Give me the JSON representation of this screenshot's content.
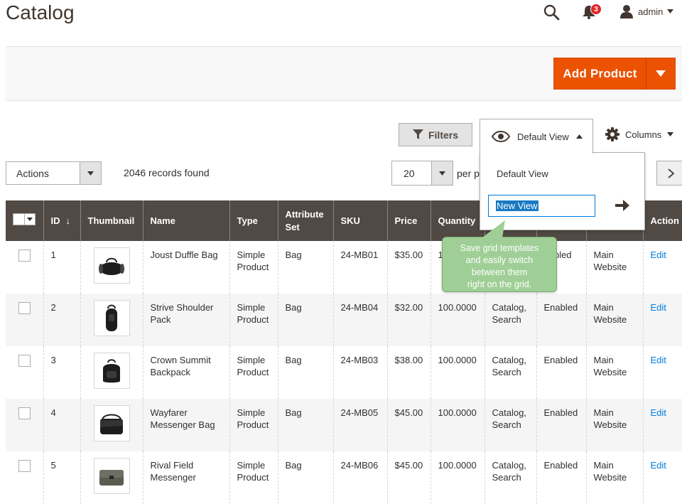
{
  "header": {
    "title": "Catalog",
    "notifications_count": "3",
    "user": "admin"
  },
  "page_actions": {
    "add_product_label": "Add Product"
  },
  "toolbar": {
    "filters_label": "Filters",
    "view_label": "Default View",
    "columns_label": "Columns",
    "actions_label": "Actions",
    "records_found": "2046 records found",
    "per_page_value": "20",
    "per_page_label": "per p"
  },
  "view_menu": {
    "default_item": "Default View",
    "new_view_value": "New View"
  },
  "tooltip": {
    "line1": "Save grid templates",
    "line2": "and easily switch",
    "line3": "between them",
    "line4": "right on the grid."
  },
  "grid": {
    "columns": {
      "id": "ID",
      "thumbnail": "Thumbnail",
      "name": "Name",
      "type": "Type",
      "attribute_set_1": "Attribute",
      "attribute_set_2": "Set",
      "sku": "SKU",
      "price": "Price",
      "quantity": "Quantity",
      "action": "Action"
    },
    "rows": [
      {
        "id": "1",
        "name_1": "Joust Duffle Bag",
        "name_2": "",
        "type_1": "Simple",
        "type_2": "Product",
        "attribute_set": "Bag",
        "sku": "24-MB01",
        "price": "$35.00",
        "quantity": "1",
        "visibility_1": "",
        "visibility_2": "",
        "status": "nabled",
        "websites_1": "Main",
        "websites_2": "Website",
        "action": "Edit",
        "thumb_icon": "duffle-bag-icon"
      },
      {
        "id": "2",
        "name_1": "Strive Shoulder",
        "name_2": "Pack",
        "type_1": "Simple",
        "type_2": "Product",
        "attribute_set": "Bag",
        "sku": "24-MB04",
        "price": "$32.00",
        "quantity": "100.0000",
        "visibility_1": "Catalog,",
        "visibility_2": "Search",
        "status": "Enabled",
        "websites_1": "Main",
        "websites_2": "Website",
        "action": "Edit",
        "thumb_icon": "shoulder-pack-icon"
      },
      {
        "id": "3",
        "name_1": "Crown Summit",
        "name_2": "Backpack",
        "type_1": "Simple",
        "type_2": "Product",
        "attribute_set": "Bag",
        "sku": "24-MB03",
        "price": "$38.00",
        "quantity": "100.0000",
        "visibility_1": "Catalog,",
        "visibility_2": "Search",
        "status": "Enabled",
        "websites_1": "Main",
        "websites_2": "Website",
        "action": "Edit",
        "thumb_icon": "backpack-icon"
      },
      {
        "id": "4",
        "name_1": "Wayfarer",
        "name_2": "Messenger Bag",
        "type_1": "Simple",
        "type_2": "Product",
        "attribute_set": "Bag",
        "sku": "24-MB05",
        "price": "$45.00",
        "quantity": "100.0000",
        "visibility_1": "Catalog,",
        "visibility_2": "Search",
        "status": "Enabled",
        "websites_1": "Main",
        "websites_2": "Website",
        "action": "Edit",
        "thumb_icon": "messenger-bag-icon"
      },
      {
        "id": "5",
        "name_1": "Rival Field",
        "name_2": "Messenger",
        "type_1": "Simple",
        "type_2": "Product",
        "attribute_set": "Bag",
        "sku": "24-MB06",
        "price": "$45.00",
        "quantity": "100.0000",
        "visibility_1": "Catalog,",
        "visibility_2": "Search",
        "status": "Enabled",
        "websites_1": "Main",
        "websites_2": "Website",
        "action": "Edit",
        "thumb_icon": "field-messenger-icon"
      }
    ]
  },
  "colors": {
    "accent": "#eb5202",
    "header_bg": "#514943",
    "tooltip_bg": "#9fcf96",
    "link": "#007bdb"
  }
}
